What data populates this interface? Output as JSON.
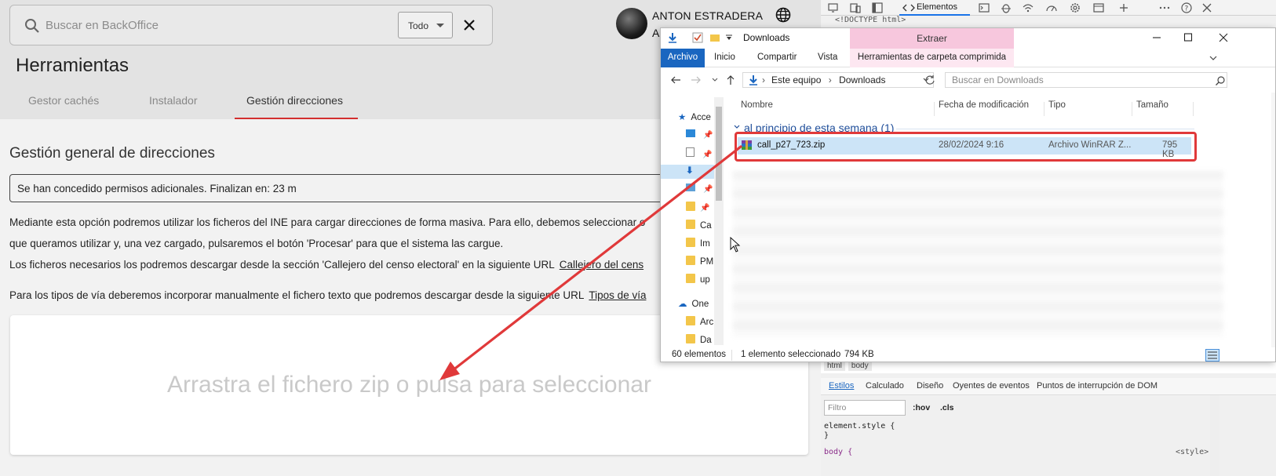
{
  "backoffice": {
    "search_placeholder": "Buscar en BackOffice",
    "filter_value": "Todo",
    "user_name": "ANTON ESTRADERA",
    "user_sub": "A",
    "page_title": "Herramientas",
    "tabs": [
      {
        "label": "Gestor cachés"
      },
      {
        "label": "Instalador"
      },
      {
        "label": "Gestión direcciones"
      }
    ],
    "section_title": "Gestión general de direcciones",
    "permission_text": "Se han concedido permisos adicionales.  Finalizan en: 23 m",
    "para1": "Mediante esta opción podremos utilizar los ficheros del INE para cargar direcciones de forma masiva. Para ello, debemos seleccionar o",
    "para2": "que queramos utilizar y, una vez cargado, pulsaremos el botón 'Procesar' para que el sistema las cargue.",
    "para3": "Los ficheros necesarios los podremos descargar desde la sección 'Callejero del censo electoral' en la siguiente URL",
    "para3_link": "Callejero del cens",
    "para4": "Para los tipos de vía deberemos incorporar manualmente el fichero texto que podremos descargar desde la siguiente URL",
    "para4_link": "Tipos de vía",
    "dropzone_text": "Arrastra el fichero zip o pulsa para seleccionar"
  },
  "devtools": {
    "elements_tab": "Elementos",
    "doctype": "<!DOCTYPE html>",
    "breadcrumb": [
      "html",
      "body"
    ],
    "style_tabs": [
      "Estilos",
      "Calculado",
      "Diseño",
      "Oyentes de eventos",
      "Puntos de interrupción de DOM"
    ],
    "filter_placeholder": "Filtro",
    "hov": ":hov",
    "cls": ".cls",
    "code_line1": "element.style {",
    "code_line2": "}",
    "code_line3": "body {",
    "style_source": "<style>"
  },
  "explorer": {
    "title": "Downloads",
    "extract_header": "Extraer",
    "ribbon_tabs": {
      "archivo": "Archivo",
      "inicio": "Inicio",
      "compartir": "Compartir",
      "vista": "Vista",
      "herramientas": "Herramientas de carpeta comprimida"
    },
    "address": {
      "part1": "Este equipo",
      "sep": "›",
      "part2": "Downloads"
    },
    "search_placeholder": "Buscar en Downloads",
    "nav_items": [
      "Acce",
      "Ca",
      "Im",
      "PM",
      "up",
      "One",
      "Arc",
      "Da"
    ],
    "columns": [
      "Nombre",
      "Fecha de modificación",
      "Tipo",
      "Tamaño"
    ],
    "group_header": "al principio de esta semana (1)",
    "file": {
      "name": "call_p27_723.zip",
      "date": "28/02/2024 9:16",
      "type": "Archivo WinRAR Z...",
      "size": "795 KB"
    },
    "status_count": "60 elementos",
    "status_selected": "1 elemento seleccionado",
    "status_size": "794 KB"
  },
  "colors": {
    "accent_red": "#d32f2f",
    "highlight_red": "#e0393a",
    "selection_blue": "#cce4f7",
    "ribbon_blue": "#1a66c0",
    "extract_pink": "#f7c7dd"
  }
}
